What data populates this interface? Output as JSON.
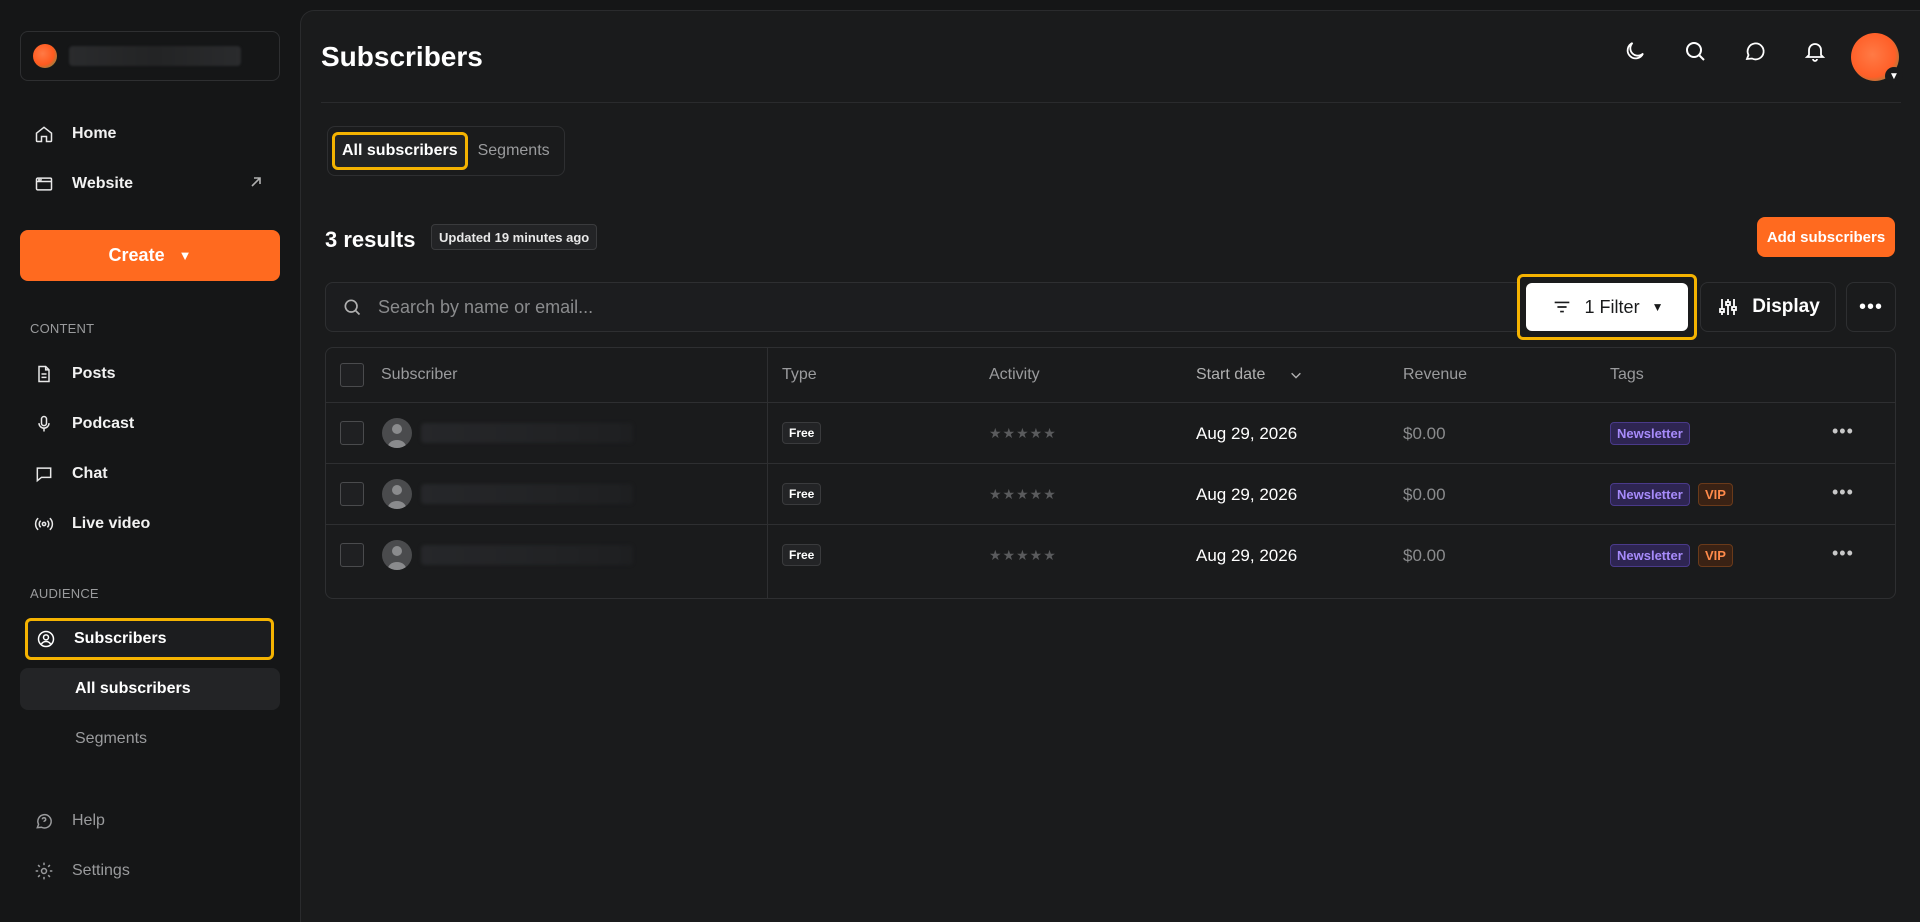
{
  "sidebar": {
    "nav": [
      {
        "label": "Home",
        "icon": "home-icon"
      },
      {
        "label": "Website",
        "icon": "browser-icon"
      }
    ],
    "create_label": "Create",
    "content_section": "CONTENT",
    "content_items": [
      {
        "label": "Posts",
        "icon": "document-icon"
      },
      {
        "label": "Podcast",
        "icon": "microphone-icon"
      },
      {
        "label": "Chat",
        "icon": "chat-icon"
      },
      {
        "label": "Live video",
        "icon": "broadcast-icon"
      }
    ],
    "audience_section": "AUDIENCE",
    "subscribers_label": "Subscribers",
    "sub_items": [
      {
        "label": "All subscribers",
        "active": true
      },
      {
        "label": "Segments",
        "active": false
      }
    ],
    "footer_items": [
      {
        "label": "Help",
        "icon": "help-icon"
      },
      {
        "label": "Settings",
        "icon": "gear-icon"
      }
    ]
  },
  "header": {
    "title": "Subscribers",
    "icons": [
      "moon-icon",
      "search-icon",
      "chat-bubble-icon",
      "bell-icon"
    ]
  },
  "tabs": [
    {
      "label": "All subscribers",
      "active": true
    },
    {
      "label": "Segments",
      "active": false
    }
  ],
  "results": {
    "count_label": "3 results",
    "updated_label": "Updated 19 minutes ago",
    "add_button": "Add subscribers"
  },
  "search": {
    "placeholder": "Search by name or email..."
  },
  "filter": {
    "label": "1 Filter"
  },
  "display": {
    "label": "Display"
  },
  "table": {
    "headers": [
      "Subscriber",
      "Type",
      "Activity",
      "Start date",
      "Revenue",
      "Tags"
    ],
    "rows": [
      {
        "type": "Free",
        "activity": "★★★★★",
        "start_date": "Aug 29, 2026",
        "revenue": "$0.00",
        "tags": [
          "Newsletter"
        ]
      },
      {
        "type": "Free",
        "activity": "★★★★★",
        "start_date": "Aug 29, 2026",
        "revenue": "$0.00",
        "tags": [
          "Newsletter",
          "VIP"
        ]
      },
      {
        "type": "Free",
        "activity": "★★★★★",
        "start_date": "Aug 29, 2026",
        "revenue": "$0.00",
        "tags": [
          "Newsletter",
          "VIP"
        ]
      }
    ]
  },
  "colors": {
    "accent": "#ff6a1f",
    "highlight": "#f5b301",
    "background": "#151617",
    "tag_newsletter": "#a78bfa",
    "tag_vip": "#ff8a4a"
  }
}
